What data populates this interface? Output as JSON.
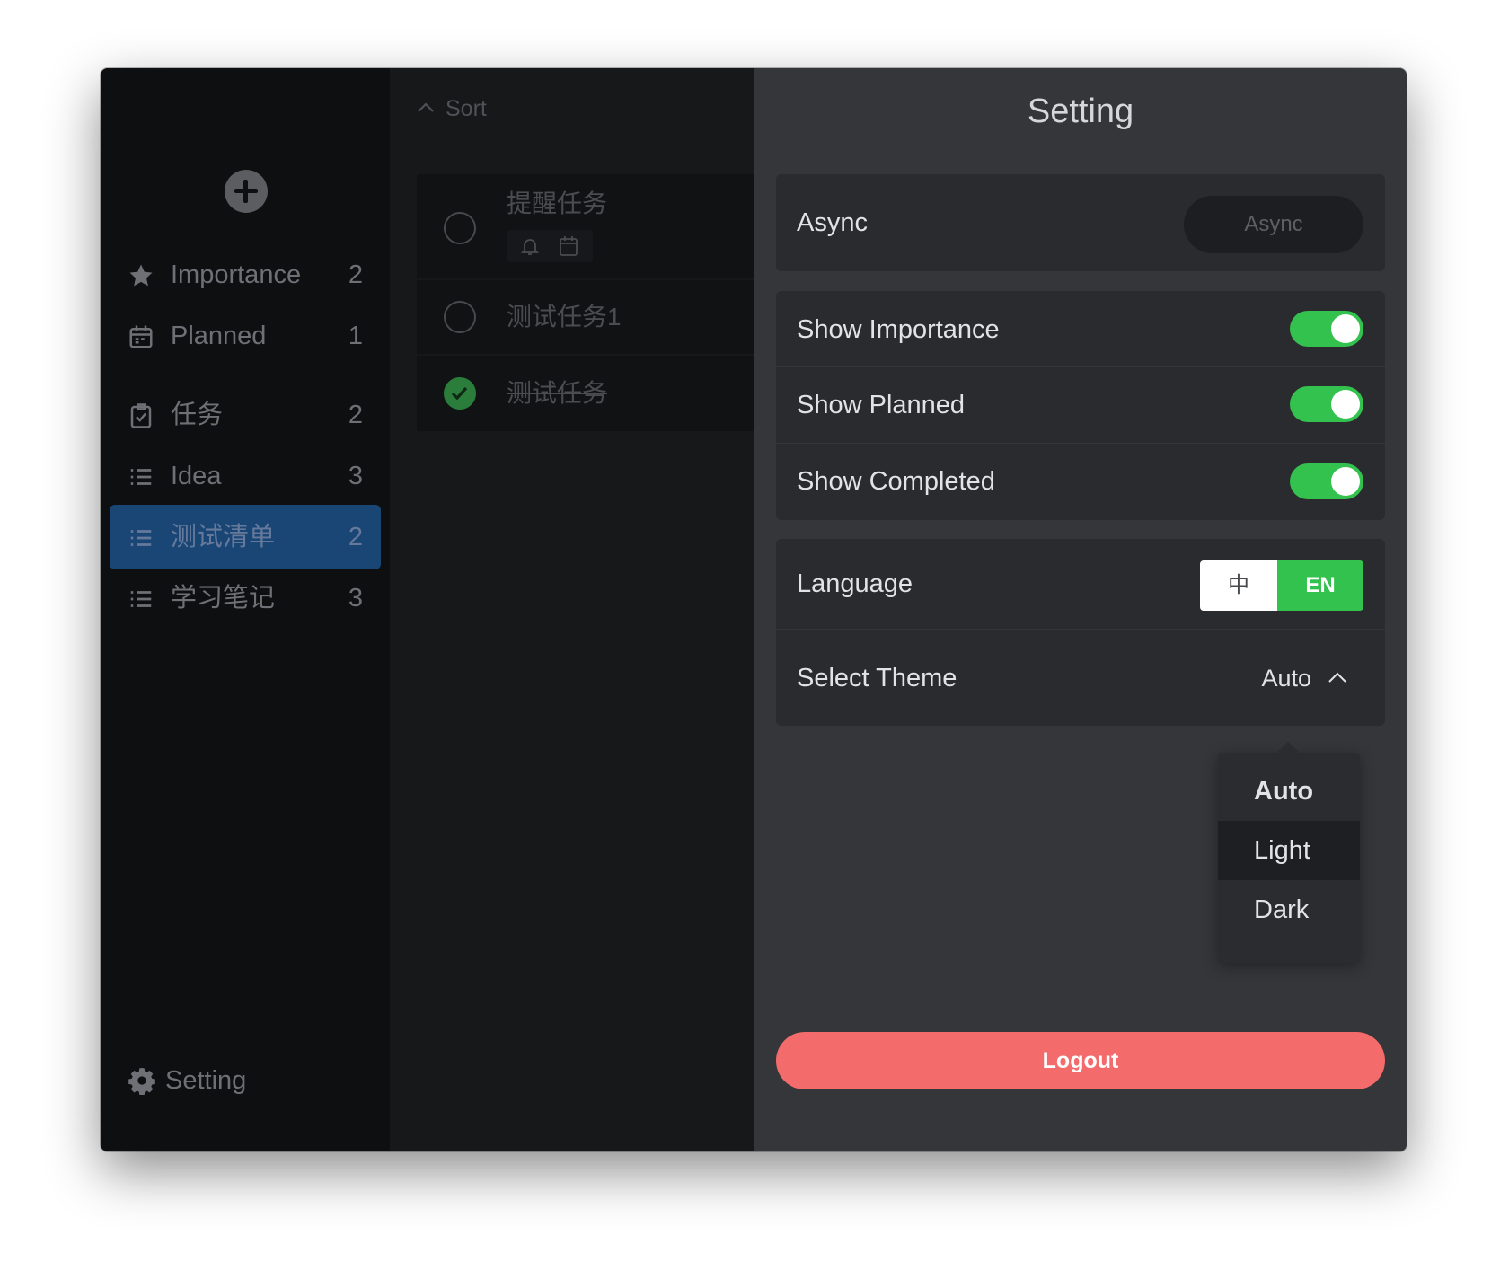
{
  "window": {
    "traffic_lights": [
      "close",
      "minimize",
      "zoom"
    ],
    "colors": {
      "close": "#fe5f57",
      "minimize": "#febc2e",
      "zoom": "#28c840"
    }
  },
  "sidebar": {
    "add_icon": "plus-circle-icon",
    "items": [
      {
        "icon": "star-icon",
        "label": "Importance",
        "count": "2"
      },
      {
        "icon": "calendar-icon",
        "label": "Planned",
        "count": "1"
      },
      {
        "icon": "clipboard-check-icon",
        "label": "任务",
        "count": "2"
      },
      {
        "icon": "list-icon",
        "label": "Idea",
        "count": "3"
      },
      {
        "icon": "list-icon",
        "label": "测试清单",
        "count": "2",
        "active": true
      },
      {
        "icon": "list-icon",
        "label": "学习笔记",
        "count": "3"
      }
    ],
    "setting": {
      "icon": "gear-icon",
      "label": "Setting"
    },
    "active_color": "#1a4676"
  },
  "tasks": {
    "sort_label": "Sort",
    "items": [
      {
        "title": "提醒任务",
        "completed": false,
        "meta_icons": [
          "bell-icon",
          "calendar-icon"
        ]
      },
      {
        "title": "测试任务1",
        "completed": false
      },
      {
        "title": "测试任务",
        "completed": true
      }
    ]
  },
  "settings": {
    "title": "Setting",
    "async": {
      "label": "Async",
      "button": "Async"
    },
    "toggles": [
      {
        "label": "Show Importance",
        "on": true
      },
      {
        "label": "Show Planned",
        "on": true
      },
      {
        "label": "Show Completed",
        "on": true
      }
    ],
    "language": {
      "label": "Language",
      "options": [
        "中",
        "EN"
      ],
      "selected": "EN"
    },
    "theme": {
      "label": "Select Theme",
      "value": "Auto",
      "options": [
        "Auto",
        "Light",
        "Dark"
      ],
      "selected": "Auto",
      "hovered": "Light"
    },
    "logout": "Logout",
    "accent_color": "#34c24e",
    "logout_color": "#f36b6b"
  }
}
